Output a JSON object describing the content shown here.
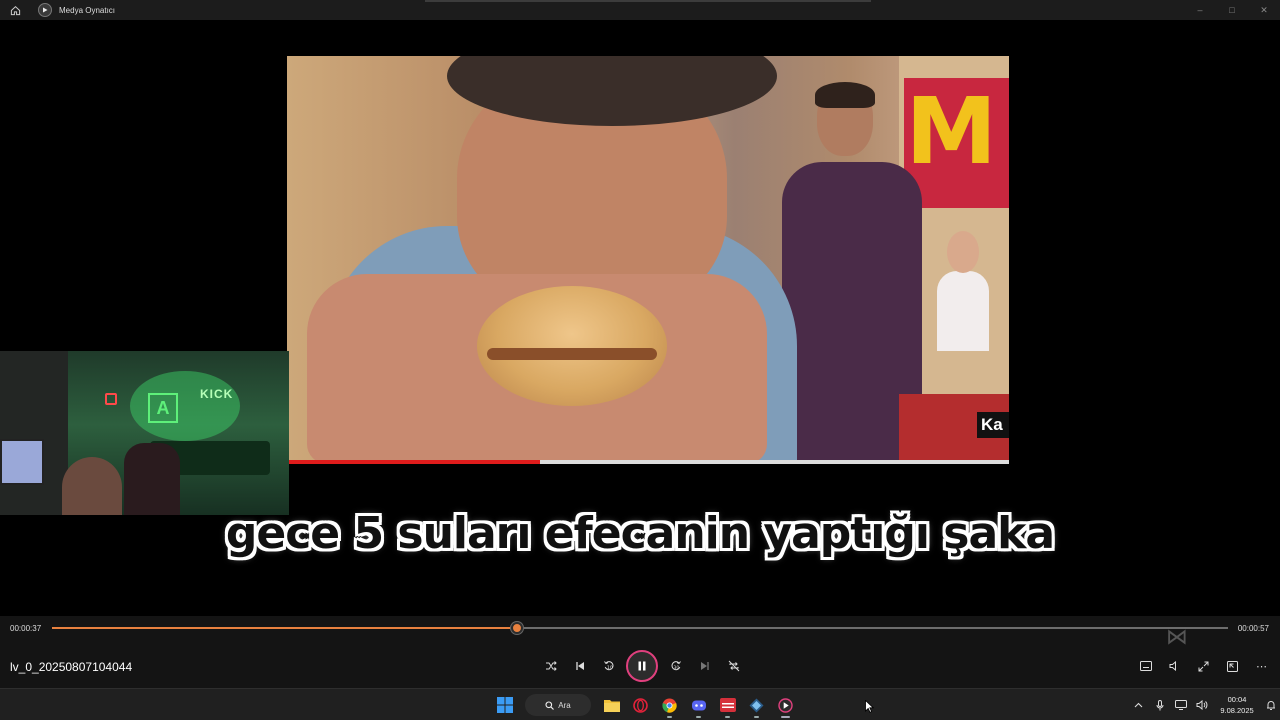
{
  "window": {
    "title": "Medya Oynatıcı"
  },
  "video": {
    "caption": "gece 5 suları efecanin yaptığı şaka",
    "corner_text": "Ka",
    "embedded_progress": 0.35
  },
  "webcam": {
    "sign_text": "KICK",
    "logo_letter": "A"
  },
  "player": {
    "current_time": "00:00:37",
    "total_time": "00:00:57",
    "progress": 0.395,
    "file_name": "lv_0_20250807104044",
    "accent_color": "#e8813f",
    "play_ring_color": "#e0407e"
  },
  "taskbar": {
    "search_label": "Ara",
    "time": "00:04",
    "date": "9.08.2025"
  }
}
